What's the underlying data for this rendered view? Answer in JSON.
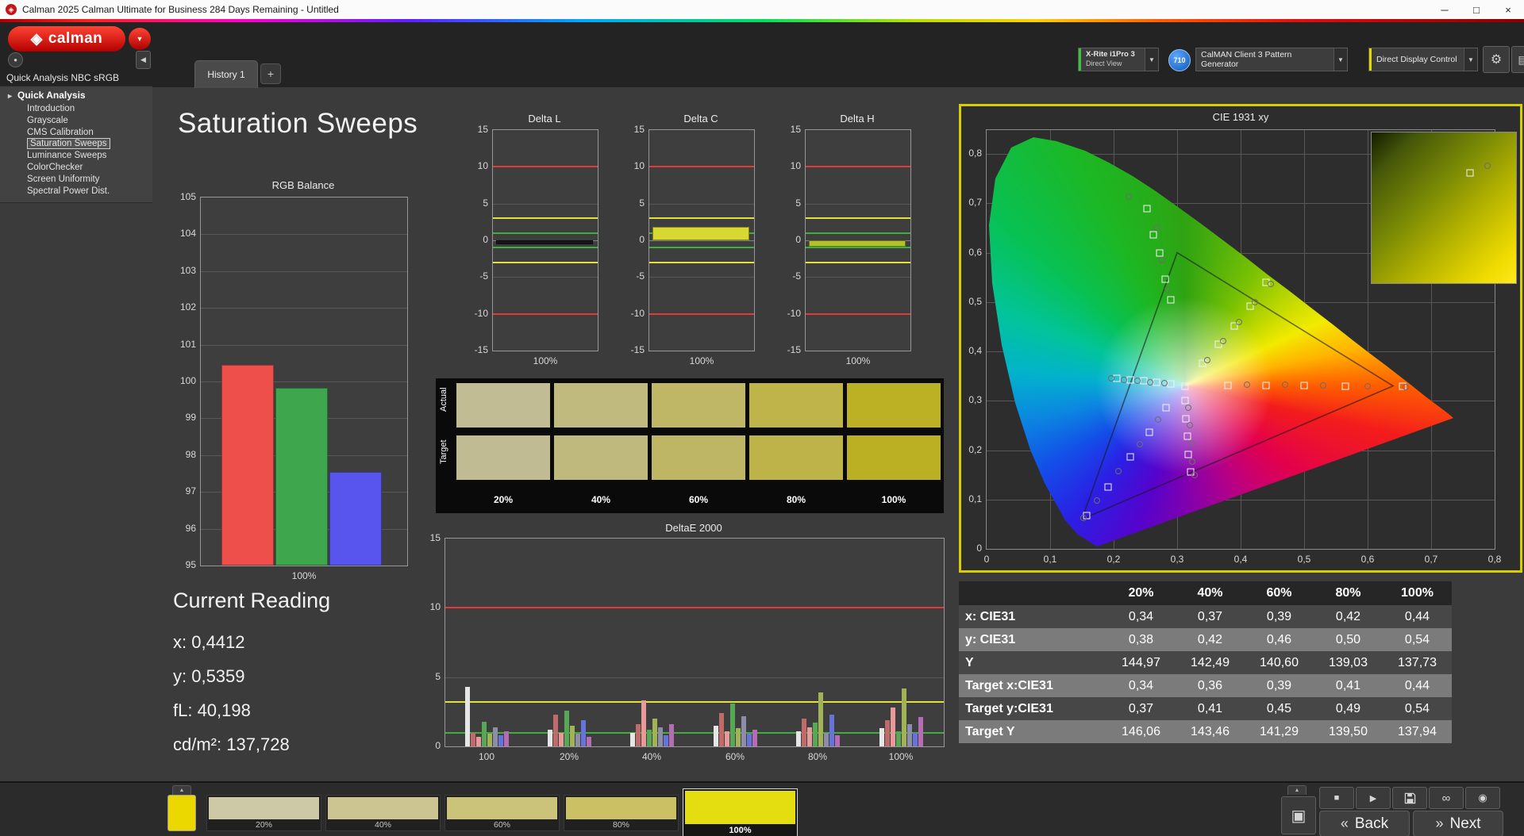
{
  "title_bar": {
    "title": "Calman 2025 Calman Ultimate for Business 284 Days Remaining  - Untitled",
    "minimize": "─",
    "maximize": "□",
    "close": "×",
    "app_icon": "◈"
  },
  "logo": {
    "text": "calman",
    "icon": "◈",
    "dropdown_icon": "▼"
  },
  "header": {
    "history_tab": "History 1",
    "add_tab": "+",
    "collapse_icon": "◀",
    "profile_icon": "●",
    "meter": {
      "line1": "X-Rite i1Pro 3",
      "line2": "Direct View",
      "arrow": "▼"
    },
    "badge": "710",
    "pattern_generator": {
      "label": "CalMAN Client 3 Pattern Generator",
      "arrow": "▼"
    },
    "display_control": {
      "label": "Direct Display Control",
      "arrow": "▼"
    },
    "gear_icon": "⚙",
    "layout_icon": "▤"
  },
  "sidebar": {
    "header": "Quick Analysis NBC sRGB",
    "root": "Quick Analysis",
    "expander": "▸",
    "items": [
      "Introduction",
      "Grayscale",
      "CMS Calibration",
      "Saturation Sweeps",
      "Luminance Sweeps",
      "ColorChecker",
      "Screen Uniformity",
      "Spectral Power Dist."
    ],
    "selected_index": 3
  },
  "page": {
    "title": "Saturation Sweeps"
  },
  "current_reading": {
    "title": "Current Reading",
    "lines": [
      "x: 0,4412",
      "y: 0,5359",
      "fL: 40,198",
      "cd/m²: 137,728"
    ]
  },
  "chart_data": [
    {
      "id": "rgb_balance",
      "type": "bar",
      "title": "RGB Balance",
      "categories": [
        "Red",
        "Green",
        "Blue"
      ],
      "values": [
        100.45,
        99.82,
        97.55
      ],
      "colors": [
        "#ee4f4b",
        "#3ea64c",
        "#5854ee"
      ],
      "ylim": [
        95,
        105
      ],
      "xlabel": "100%"
    },
    {
      "id": "delta_l",
      "type": "bar",
      "title": "Delta L",
      "categories": [
        "100%"
      ],
      "values": [
        -0.5
      ],
      "bar_color": "#161616",
      "ylim": [
        -15,
        15
      ],
      "xlabel": "100%",
      "ref_lines": [
        {
          "value": 10,
          "color": "#e03a3a"
        },
        {
          "value": -10,
          "color": "#e03a3a"
        },
        {
          "value": 3,
          "color": "#e2e23c"
        },
        {
          "value": -3,
          "color": "#e2e23c"
        },
        {
          "value": 1,
          "color": "#3fae3f"
        },
        {
          "value": -1,
          "color": "#3fae3f"
        }
      ]
    },
    {
      "id": "delta_c",
      "type": "bar",
      "title": "Delta C",
      "categories": [
        "100%"
      ],
      "values": [
        1.8
      ],
      "bar_color": "#d8d832",
      "ylim": [
        -15,
        15
      ],
      "xlabel": "100%",
      "ref_lines": [
        {
          "value": 10,
          "color": "#e03a3a"
        },
        {
          "value": -10,
          "color": "#e03a3a"
        },
        {
          "value": 3,
          "color": "#e2e23c"
        },
        {
          "value": -3,
          "color": "#e2e23c"
        },
        {
          "value": 1,
          "color": "#3fae3f"
        },
        {
          "value": -1,
          "color": "#3fae3f"
        }
      ]
    },
    {
      "id": "delta_h",
      "type": "bar",
      "title": "Delta H",
      "categories": [
        "100%"
      ],
      "values": [
        -0.9
      ],
      "bar_color": "#b2c22a",
      "ylim": [
        -15,
        15
      ],
      "xlabel": "100%",
      "ref_lines": [
        {
          "value": 10,
          "color": "#e03a3a"
        },
        {
          "value": -10,
          "color": "#e03a3a"
        },
        {
          "value": 3,
          "color": "#e2e23c"
        },
        {
          "value": -3,
          "color": "#e2e23c"
        },
        {
          "value": 1,
          "color": "#3fae3f"
        },
        {
          "value": -1,
          "color": "#3fae3f"
        }
      ]
    },
    {
      "id": "delta_e",
      "type": "bar",
      "title": "DeltaE 2000",
      "categories": [
        "100",
        "20%",
        "40%",
        "60%",
        "80%",
        "100%"
      ],
      "ylim": [
        0,
        15
      ],
      "ref_lines": [
        {
          "value": 10,
          "color": "#e03a3a"
        },
        {
          "value": 3.2,
          "color": "#e2e23c"
        },
        {
          "value": 1,
          "color": "#3fae3f"
        }
      ],
      "series_colors": [
        "#e6e6e6",
        "#c06a6a",
        "#e89a9a",
        "#57a757",
        "#a2b257",
        "#8d8da9",
        "#6673d9",
        "#b56cb5"
      ],
      "groups": [
        [
          4.3,
          1.0,
          0.7,
          1.8,
          0.9,
          1.4,
          0.8,
          1.1
        ],
        [
          1.2,
          2.3,
          1.0,
          2.6,
          1.5,
          0.9,
          1.9,
          0.7
        ],
        [
          1.0,
          1.6,
          3.3,
          1.2,
          2.0,
          1.4,
          0.8,
          1.6
        ],
        [
          1.5,
          2.4,
          1.1,
          3.1,
          1.3,
          2.2,
          0.9,
          1.2
        ],
        [
          1.1,
          2.0,
          1.4,
          1.7,
          3.9,
          1.0,
          2.3,
          0.8
        ],
        [
          1.3,
          1.9,
          2.8,
          1.1,
          4.2,
          1.6,
          1.0,
          2.1
        ]
      ]
    },
    {
      "id": "cie",
      "type": "scatter",
      "title": "CIE 1931 xy",
      "xlim": [
        0,
        0.8
      ],
      "ylim": [
        0,
        0.8
      ],
      "x_ticks": [
        "0",
        "0,1",
        "0,2",
        "0,3",
        "0,4",
        "0,5",
        "0,6",
        "0,7",
        "0,8"
      ],
      "y_ticks": [
        "0",
        "0,1",
        "0,2",
        "0,3",
        "0,4",
        "0,5",
        "0,6",
        "0,7",
        "0,8"
      ],
      "srgb_triangle": [
        [
          0.64,
          0.33
        ],
        [
          0.3,
          0.6
        ],
        [
          0.15,
          0.06
        ]
      ],
      "targets": [
        [
          0.313,
          0.329
        ],
        [
          0.253,
          0.69
        ],
        [
          0.263,
          0.636
        ],
        [
          0.272,
          0.6
        ],
        [
          0.281,
          0.547
        ],
        [
          0.29,
          0.505
        ],
        [
          0.34,
          0.376
        ],
        [
          0.365,
          0.414
        ],
        [
          0.39,
          0.452
        ],
        [
          0.415,
          0.492
        ],
        [
          0.44,
          0.54
        ],
        [
          0.38,
          0.331
        ],
        [
          0.44,
          0.331
        ],
        [
          0.5,
          0.331
        ],
        [
          0.565,
          0.33
        ],
        [
          0.655,
          0.329
        ],
        [
          0.205,
          0.345
        ],
        [
          0.226,
          0.342
        ],
        [
          0.247,
          0.34
        ],
        [
          0.268,
          0.337
        ],
        [
          0.29,
          0.335
        ],
        [
          0.283,
          0.286
        ],
        [
          0.256,
          0.236
        ],
        [
          0.226,
          0.186
        ],
        [
          0.191,
          0.126
        ],
        [
          0.157,
          0.068
        ],
        [
          0.312,
          0.3
        ],
        [
          0.314,
          0.264
        ],
        [
          0.316,
          0.228
        ],
        [
          0.318,
          0.192
        ],
        [
          0.321,
          0.156
        ]
      ],
      "measurements": [
        [
          0.224,
          0.714
        ],
        [
          0.268,
          0.65
        ],
        [
          0.276,
          0.585
        ],
        [
          0.285,
          0.525
        ],
        [
          0.347,
          0.383
        ],
        [
          0.372,
          0.421
        ],
        [
          0.397,
          0.459
        ],
        [
          0.423,
          0.499
        ],
        [
          0.447,
          0.536
        ],
        [
          0.41,
          0.333
        ],
        [
          0.47,
          0.332
        ],
        [
          0.53,
          0.331
        ],
        [
          0.6,
          0.33
        ],
        [
          0.66,
          0.328
        ],
        [
          0.196,
          0.346
        ],
        [
          0.216,
          0.343
        ],
        [
          0.237,
          0.341
        ],
        [
          0.258,
          0.338
        ],
        [
          0.28,
          0.336
        ],
        [
          0.27,
          0.262
        ],
        [
          0.241,
          0.212
        ],
        [
          0.208,
          0.158
        ],
        [
          0.174,
          0.098
        ],
        [
          0.152,
          0.062
        ],
        [
          0.318,
          0.286
        ],
        [
          0.32,
          0.25
        ],
        [
          0.322,
          0.214
        ],
        [
          0.324,
          0.176
        ],
        [
          0.327,
          0.15
        ]
      ]
    }
  ],
  "saturation_swatches": {
    "row_labels": [
      "Actual",
      "Target"
    ],
    "columns": [
      "20%",
      "40%",
      "60%",
      "80%",
      "100%"
    ],
    "actual": [
      "#c1bc93",
      "#c1ba7e",
      "#bfb765",
      "#beb449",
      "#bcb125"
    ],
    "target": [
      "#c0bb92",
      "#c0b97d",
      "#beb664",
      "#bdb348",
      "#bbb024"
    ]
  },
  "results_table": {
    "columns": [
      "20%",
      "40%",
      "60%",
      "80%",
      "100%"
    ],
    "rows": [
      {
        "label": "x: CIE31",
        "values": [
          "0,34",
          "0,37",
          "0,39",
          "0,42",
          "0,44"
        ]
      },
      {
        "label": "y: CIE31",
        "values": [
          "0,38",
          "0,42",
          "0,46",
          "0,50",
          "0,54"
        ]
      },
      {
        "label": "Y",
        "values": [
          "144,97",
          "142,49",
          "140,60",
          "139,03",
          "137,73"
        ]
      },
      {
        "label": "Target x:CIE31",
        "values": [
          "0,34",
          "0,36",
          "0,39",
          "0,41",
          "0,44"
        ]
      },
      {
        "label": "Target y:CIE31",
        "values": [
          "0,37",
          "0,41",
          "0,45",
          "0,49",
          "0,54"
        ]
      },
      {
        "label": "Target Y",
        "values": [
          "146,06",
          "143,46",
          "141,29",
          "139,50",
          "137,94"
        ]
      }
    ]
  },
  "bottom_bar": {
    "swatches": [
      {
        "label": "20%",
        "color": "#cdc8a6",
        "active": false
      },
      {
        "label": "40%",
        "color": "#cdc591",
        "active": false
      },
      {
        "label": "60%",
        "color": "#ccc37b",
        "active": false
      },
      {
        "label": "80%",
        "color": "#cbc164",
        "active": false
      },
      {
        "label": "100%",
        "color": "#e4de10",
        "active": true
      }
    ],
    "eject_icon": "▲",
    "stop_icon": "■",
    "play_icon": "▶",
    "loop_icon": "∞",
    "capture_icon": "◉",
    "pattern_icon": "▣",
    "back_icon": "«",
    "next_icon": "»",
    "back": "Back",
    "next": "Next"
  }
}
